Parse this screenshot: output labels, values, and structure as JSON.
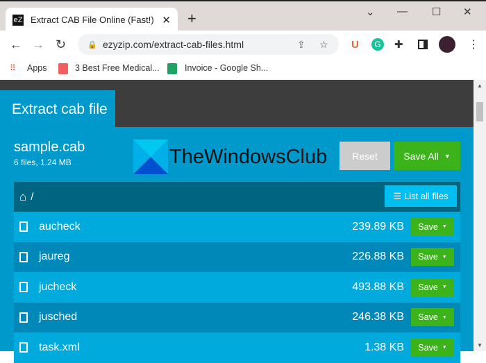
{
  "browser": {
    "tab_title": "Extract CAB File Online (Fast!)",
    "favicon": "eZ",
    "url": "ezyzip.com/extract-cab-files.html",
    "bookmarks": [
      "Apps",
      "3 Best Free Medical...",
      "Invoice - Google Sh..."
    ]
  },
  "page": {
    "tab": "Extract cab file",
    "file_name": "sample.cab",
    "file_meta": "6 files, 1.24 MB",
    "watermark": "TheWindowsClub",
    "reset": "Reset",
    "save_all": "Save All",
    "path": "/",
    "list_all": "List all files",
    "files": [
      {
        "name": "aucheck",
        "size": "239.89 KB"
      },
      {
        "name": "jaureg",
        "size": "226.88 KB"
      },
      {
        "name": "jucheck",
        "size": "493.88 KB"
      },
      {
        "name": "jusched",
        "size": "246.38 KB"
      },
      {
        "name": "task.xml",
        "size": "1.38 KB"
      }
    ],
    "save": "Save"
  },
  "colors": {
    "row_light": "#00aadd",
    "row_dark": "#0088b8",
    "green": "#3cb31a"
  }
}
